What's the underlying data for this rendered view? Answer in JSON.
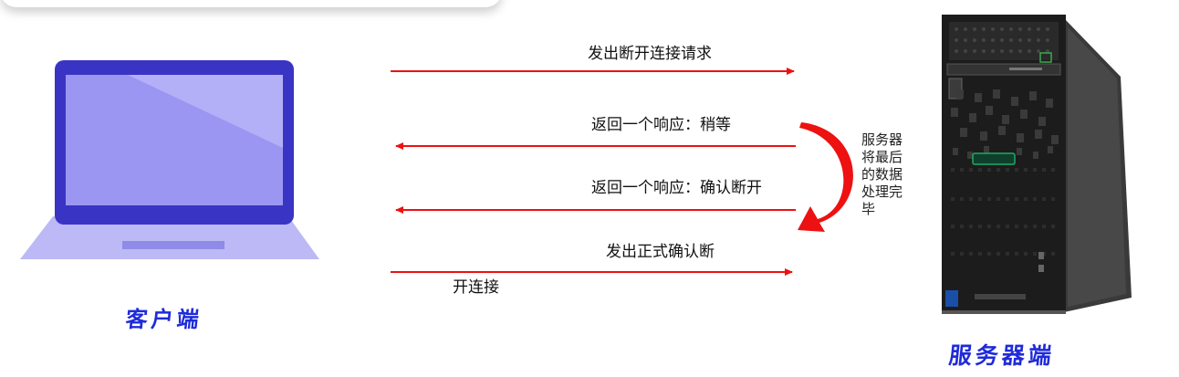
{
  "colors": {
    "arrow": "#ee1111",
    "label_blue": "#1f2bd9",
    "laptop_frame": "#3a34c4",
    "laptop_screen": "#9b96f2",
    "laptop_base": "#b9b6f5",
    "server_body": "#1c1c1c"
  },
  "icons": {
    "client": "laptop-icon",
    "server": "tower-server-icon"
  },
  "client": {
    "label": "客户端"
  },
  "server": {
    "label": "服务器端"
  },
  "messages": {
    "m1": "发出断开连接请求",
    "m2": "返回一个响应：稍等",
    "m3": "返回一个响应：确认断开",
    "m4_line1": "发出正式确认断",
    "m4_line2": "开连接"
  },
  "server_note": [
    "服务器",
    "将最后",
    "的数据",
    "处理完",
    "毕"
  ]
}
